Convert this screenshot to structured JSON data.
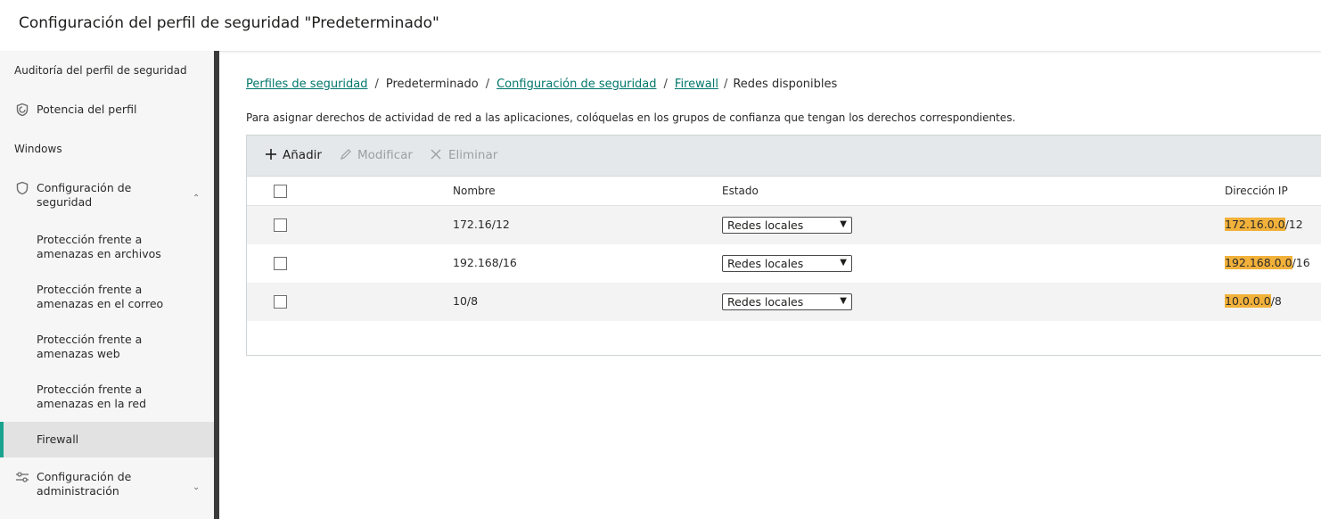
{
  "window": {
    "title": "Configuración del perfil de seguridad \"Predeterminado\""
  },
  "sidebar": {
    "audit": "Auditoría del perfil de seguridad",
    "strength": {
      "label": "Potencia del perfil",
      "icon": "shield-check-icon"
    },
    "windows": "Windows",
    "security_settings": {
      "label_line1": "Configuración de",
      "label_line2": "seguridad",
      "icon": "shield-icon",
      "expanded": true
    },
    "items": [
      {
        "line1": "Protección frente a",
        "line2": "amenazas en archivos"
      },
      {
        "line1": "Protección frente a",
        "line2": "amenazas en el correo"
      },
      {
        "line1": "Protección frente a",
        "line2": "amenazas web"
      },
      {
        "line1": "Protección frente a",
        "line2": "amenazas en la red"
      },
      {
        "line1": "Firewall",
        "line2": "",
        "active": true
      }
    ],
    "admin_settings": {
      "label_line1": "Configuración de",
      "label_line2": "administración",
      "icon": "sliders-icon",
      "expanded": false
    }
  },
  "breadcrumb": {
    "profiles": "Perfiles de seguridad",
    "default": "Predeterminado",
    "security_config": "Configuración de seguridad",
    "firewall": "Firewall",
    "current": "Redes disponibles",
    "separator": "/"
  },
  "description": "Para asignar derechos de actividad de red a las aplicaciones, colóquelas en los grupos de confianza que tengan los derechos correspondientes.",
  "toolbar": {
    "add": "Añadir",
    "modify": "Modificar",
    "delete": "Eliminar"
  },
  "table": {
    "columns": {
      "name": "Nombre",
      "state": "Estado",
      "ip": "Dirección IP"
    },
    "rows": [
      {
        "name": "172.16/12",
        "state": "Redes locales",
        "ip_highlight": "172.16.0.0",
        "ip_suffix": "/12"
      },
      {
        "name": "192.168/16",
        "state": "Redes locales",
        "ip_highlight": "192.168.0.0",
        "ip_suffix": "/16"
      },
      {
        "name": "10/8",
        "state": "Redes locales",
        "ip_highlight": "10.0.0.0",
        "ip_suffix": "/8"
      }
    ]
  },
  "colors": {
    "accent": "#19a38f",
    "link": "#00766a",
    "highlight": "#f2b13a",
    "toolbar_bg": "#e4e8ea"
  }
}
